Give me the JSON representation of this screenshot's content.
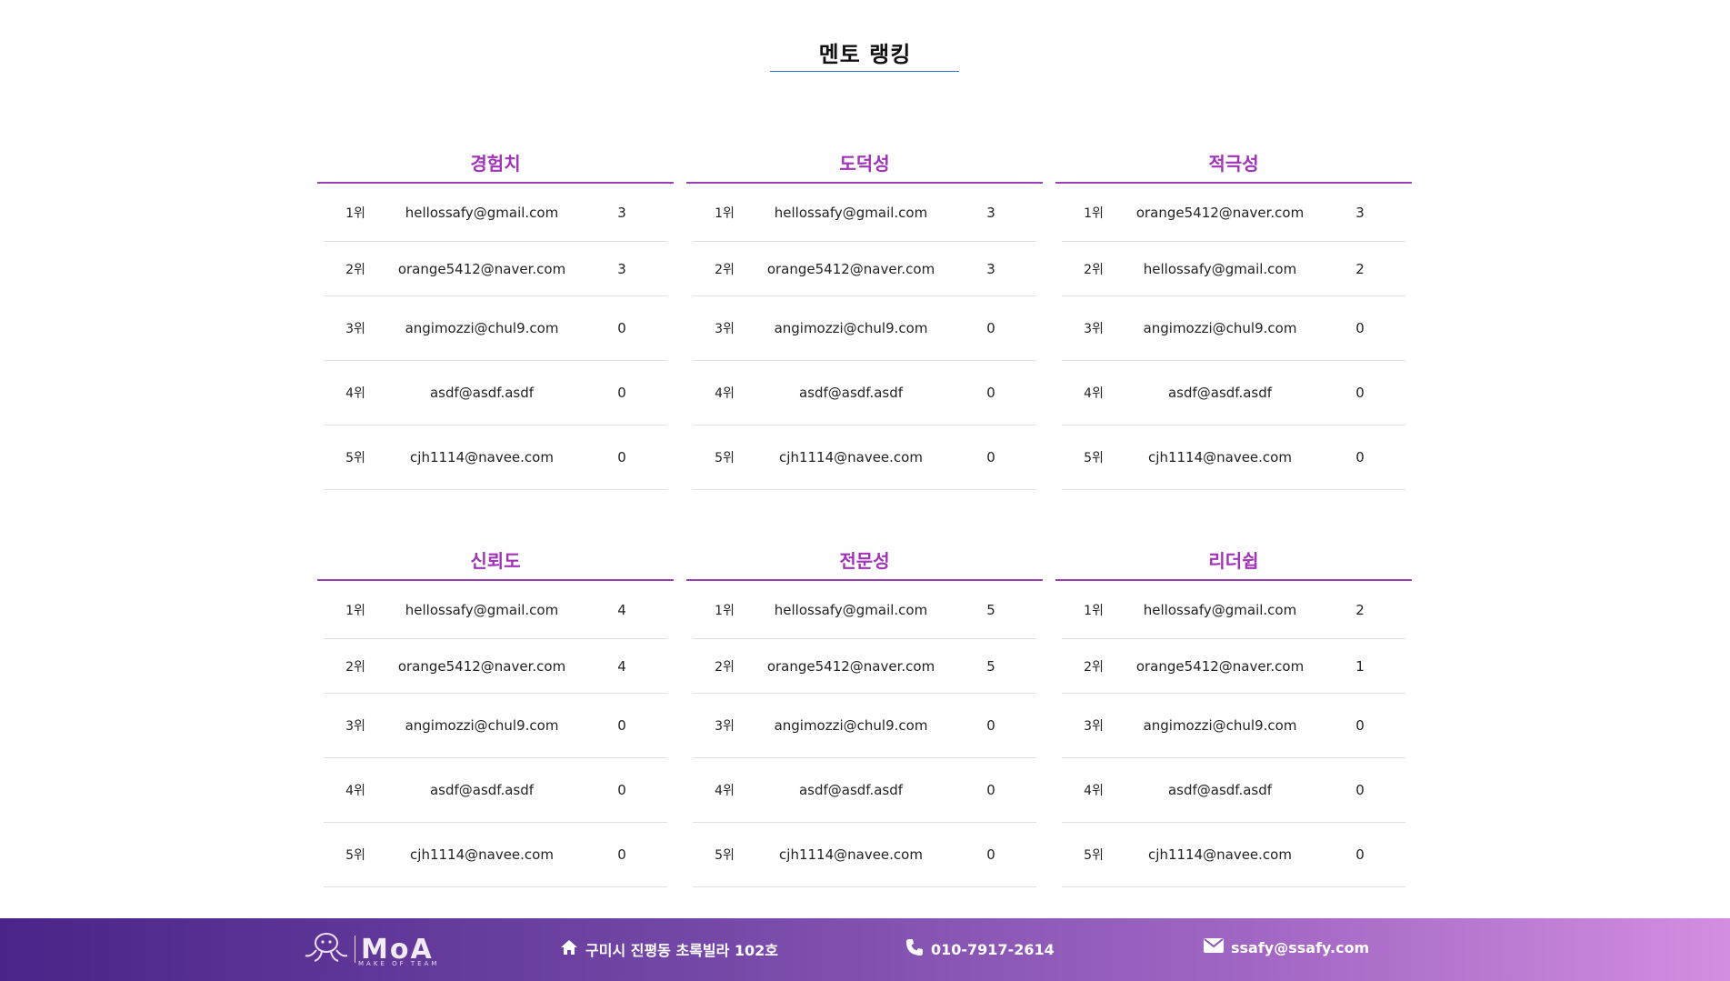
{
  "page": {
    "title": "멘토 랭킹"
  },
  "boards": [
    {
      "title": "경험치",
      "rows": [
        {
          "rank": "1위",
          "email": "hellossafy@gmail.com",
          "score": "3"
        },
        {
          "rank": "2위",
          "email": "orange5412@naver.com",
          "score": "3"
        },
        {
          "rank": "3위",
          "email": "angimozzi@chul9.com",
          "score": "0"
        },
        {
          "rank": "4위",
          "email": "asdf@asdf.asdf",
          "score": "0"
        },
        {
          "rank": "5위",
          "email": "cjh1114@navee.com",
          "score": "0"
        }
      ]
    },
    {
      "title": "도덕성",
      "rows": [
        {
          "rank": "1위",
          "email": "hellossafy@gmail.com",
          "score": "3"
        },
        {
          "rank": "2위",
          "email": "orange5412@naver.com",
          "score": "3"
        },
        {
          "rank": "3위",
          "email": "angimozzi@chul9.com",
          "score": "0"
        },
        {
          "rank": "4위",
          "email": "asdf@asdf.asdf",
          "score": "0"
        },
        {
          "rank": "5위",
          "email": "cjh1114@navee.com",
          "score": "0"
        }
      ]
    },
    {
      "title": "적극성",
      "rows": [
        {
          "rank": "1위",
          "email": "orange5412@naver.com",
          "score": "3"
        },
        {
          "rank": "2위",
          "email": "hellossafy@gmail.com",
          "score": "2"
        },
        {
          "rank": "3위",
          "email": "angimozzi@chul9.com",
          "score": "0"
        },
        {
          "rank": "4위",
          "email": "asdf@asdf.asdf",
          "score": "0"
        },
        {
          "rank": "5위",
          "email": "cjh1114@navee.com",
          "score": "0"
        }
      ]
    },
    {
      "title": "신뢰도",
      "rows": [
        {
          "rank": "1위",
          "email": "hellossafy@gmail.com",
          "score": "4"
        },
        {
          "rank": "2위",
          "email": "orange5412@naver.com",
          "score": "4"
        },
        {
          "rank": "3위",
          "email": "angimozzi@chul9.com",
          "score": "0"
        },
        {
          "rank": "4위",
          "email": "asdf@asdf.asdf",
          "score": "0"
        },
        {
          "rank": "5위",
          "email": "cjh1114@navee.com",
          "score": "0"
        }
      ]
    },
    {
      "title": "전문성",
      "rows": [
        {
          "rank": "1위",
          "email": "hellossafy@gmail.com",
          "score": "5"
        },
        {
          "rank": "2위",
          "email": "orange5412@naver.com",
          "score": "5"
        },
        {
          "rank": "3위",
          "email": "angimozzi@chul9.com",
          "score": "0"
        },
        {
          "rank": "4위",
          "email": "asdf@asdf.asdf",
          "score": "0"
        },
        {
          "rank": "5위",
          "email": "cjh1114@navee.com",
          "score": "0"
        }
      ]
    },
    {
      "title": "리더쉽",
      "rows": [
        {
          "rank": "1위",
          "email": "hellossafy@gmail.com",
          "score": "2"
        },
        {
          "rank": "2위",
          "email": "orange5412@naver.com",
          "score": "1"
        },
        {
          "rank": "3위",
          "email": "angimozzi@chul9.com",
          "score": "0"
        },
        {
          "rank": "4위",
          "email": "asdf@asdf.asdf",
          "score": "0"
        },
        {
          "rank": "5위",
          "email": "cjh1114@navee.com",
          "score": "0"
        }
      ]
    }
  ],
  "footer": {
    "logo_text": "MoA",
    "logo_sub": "MAKE OF TEAM",
    "address": "구미시 진평동 초록빌라 102호",
    "phone": "010-7917-2614",
    "email": "ssafy@ssafy.com",
    "icons": {
      "address": "home-icon",
      "phone": "phone-icon",
      "email": "mail-icon"
    }
  },
  "colors": {
    "accent": "#a033b8",
    "title_underline": "#3b6fd4",
    "footer_start": "#4a2488",
    "footer_end": "#d38ee0"
  }
}
